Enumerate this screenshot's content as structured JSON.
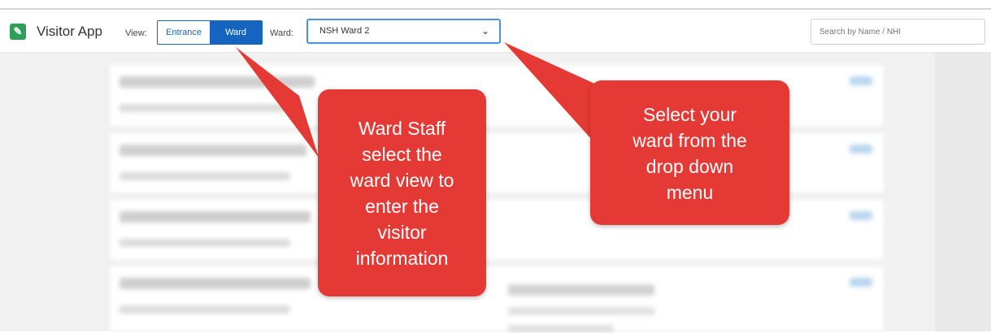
{
  "app": {
    "title": "Visitor App"
  },
  "header": {
    "view_label": "View:",
    "view_options": [
      "Entrance",
      "Ward"
    ],
    "selected_view": "Ward",
    "ward_label": "Ward:",
    "ward_selected": "NSH Ward 2",
    "search_placeholder": "Search by Name / NHI"
  },
  "callouts": {
    "left": [
      "Ward Staff",
      "select the",
      "ward view to",
      "enter the",
      "visitor",
      "information"
    ],
    "right": [
      "Select your",
      "ward from the",
      "drop down",
      "menu"
    ]
  },
  "colors": {
    "accent": "#1565c0",
    "callout": "#e53935",
    "logo": "#2e9e5b"
  }
}
